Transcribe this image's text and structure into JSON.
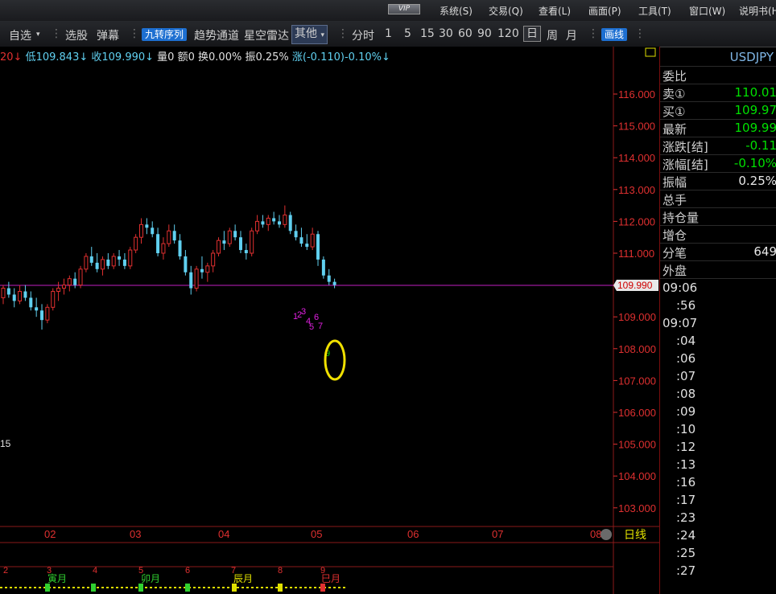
{
  "menubar": {
    "vip_label": "VIP",
    "items": [
      "系统(S)",
      "交易(Q)",
      "查看(L)",
      "画面(P)",
      "工具(T)",
      "窗口(W)",
      "说明书(H)"
    ]
  },
  "toolbar": {
    "favorites": "自选",
    "stock_pick": "选股",
    "popup": "弹幕",
    "nine_turn": "九转序列",
    "trend_channel": "趋势通道",
    "radar": "星空雷达",
    "other": "其他",
    "intraday": "分时",
    "periods": [
      "1",
      "5",
      "15",
      "30",
      "60",
      "90",
      "120"
    ],
    "day": "日",
    "week": "周",
    "month": "月",
    "draw_line": "画线"
  },
  "infoline": {
    "prefix": "20↓",
    "low": "低109.843↓",
    "close": "收109.990↓",
    "volume": "量0",
    "amount": "额0",
    "turnover": "换0.00%",
    "amplitude": "振0.25%",
    "change": "涨(-0.110)-0.10%↓"
  },
  "price_axis": {
    "ticks": [
      "116.000",
      "115.000",
      "114.000",
      "113.000",
      "112.000",
      "111.000",
      "110.000",
      "109.000",
      "108.000",
      "107.000",
      "106.000",
      "105.000",
      "104.000",
      "103.000"
    ],
    "current_price": "109.990"
  },
  "time_axis": {
    "ticks": [
      "02",
      "03",
      "04",
      "05",
      "06",
      "07",
      "08"
    ],
    "period_label": "日线"
  },
  "left_label": "15",
  "nine_turn_labels": [
    "1",
    "2",
    "3",
    "4",
    "5",
    "6",
    "7",
    "9"
  ],
  "bottom_strip": {
    "numbers": [
      "2",
      "3",
      "4",
      "5",
      "6",
      "7",
      "8",
      "9"
    ],
    "months": [
      "寅月",
      "卯月",
      "辰月",
      "巳月"
    ]
  },
  "quote": {
    "symbol": "USDJPY",
    "rows": [
      {
        "label": "委比",
        "value": "",
        "color": "#d0d0d0"
      },
      {
        "label": "卖①",
        "value": "110.01",
        "color": "#00e000"
      },
      {
        "label": "买①",
        "value": "109.97",
        "color": "#00e000"
      },
      {
        "label": "最新",
        "value": "109.99",
        "color": "#00e000"
      },
      {
        "label": "涨跌[结]",
        "value": "-0.11",
        "color": "#00e000"
      },
      {
        "label": "涨幅[结]",
        "value": "-0.10%",
        "color": "#00e000"
      },
      {
        "label": "振幅",
        "value": "0.25%",
        "color": "#e8e8e8"
      },
      {
        "label": "总手",
        "value": "",
        "color": "#e8e8e8"
      },
      {
        "label": "持仓量",
        "value": "",
        "color": "#e8e8e8"
      },
      {
        "label": "增仓",
        "value": "",
        "color": "#e8e8e8"
      },
      {
        "label": "分笔",
        "value": "649",
        "color": "#e8e8e8"
      },
      {
        "label": "外盘",
        "value": "",
        "color": "#e8e8e8"
      }
    ],
    "times": [
      "09:06",
      ":56",
      "09:07",
      ":04",
      ":06",
      ":07",
      ":08",
      ":09",
      ":10",
      ":12",
      ":13",
      ":16",
      ":17",
      ":23",
      ":24",
      ":25",
      ":27"
    ]
  },
  "colors": {
    "up": "#e03030",
    "down": "#60d0f0",
    "nine_turn": "#e020e0",
    "highlight_circle": "#f0e000",
    "price_line": "#c020c0"
  },
  "chart_data": {
    "type": "candlestick",
    "symbol": "USDJPY",
    "last_close": 109.99,
    "ylim": [
      102.6,
      116.6
    ],
    "candles": [
      [
        109.6,
        110.0,
        109.4,
        109.9
      ],
      [
        109.9,
        110.1,
        109.6,
        109.7
      ],
      [
        109.7,
        109.9,
        109.3,
        109.5
      ],
      [
        109.5,
        110.0,
        109.4,
        109.8
      ],
      [
        109.8,
        110.0,
        109.5,
        109.6
      ],
      [
        109.6,
        109.8,
        109.2,
        109.3
      ],
      [
        109.3,
        109.6,
        109.0,
        109.2
      ],
      [
        109.2,
        109.4,
        108.6,
        108.9
      ],
      [
        108.9,
        109.4,
        108.8,
        109.3
      ],
      [
        109.3,
        109.9,
        109.2,
        109.8
      ],
      [
        109.8,
        110.1,
        109.5,
        109.9
      ],
      [
        109.9,
        110.2,
        109.7,
        110.0
      ],
      [
        110.0,
        110.3,
        109.8,
        110.2
      ],
      [
        110.2,
        110.4,
        109.9,
        110.0
      ],
      [
        110.0,
        110.6,
        109.9,
        110.5
      ],
      [
        110.5,
        111.0,
        110.4,
        110.9
      ],
      [
        110.9,
        111.2,
        110.6,
        110.7
      ],
      [
        110.7,
        111.0,
        110.4,
        110.5
      ],
      [
        110.5,
        110.9,
        110.3,
        110.8
      ],
      [
        110.8,
        111.0,
        110.5,
        110.6
      ],
      [
        110.6,
        111.0,
        110.5,
        110.9
      ],
      [
        110.9,
        111.1,
        110.6,
        110.8
      ],
      [
        110.8,
        111.0,
        110.5,
        110.6
      ],
      [
        110.6,
        111.2,
        110.5,
        111.1
      ],
      [
        111.1,
        111.6,
        111.0,
        111.5
      ],
      [
        111.5,
        112.1,
        111.3,
        111.9
      ],
      [
        111.9,
        112.1,
        111.6,
        111.8
      ],
      [
        111.8,
        112.0,
        111.5,
        111.6
      ],
      [
        111.6,
        111.8,
        110.9,
        111.0
      ],
      [
        111.0,
        111.5,
        110.8,
        111.3
      ],
      [
        111.3,
        111.9,
        111.2,
        111.7
      ],
      [
        111.7,
        111.9,
        111.3,
        111.4
      ],
      [
        111.4,
        111.6,
        110.8,
        110.9
      ],
      [
        110.9,
        111.1,
        110.3,
        110.4
      ],
      [
        110.4,
        110.6,
        109.7,
        109.9
      ],
      [
        109.9,
        110.6,
        109.8,
        110.5
      ],
      [
        110.5,
        110.9,
        110.2,
        110.4
      ],
      [
        110.4,
        110.7,
        110.1,
        110.6
      ],
      [
        110.6,
        111.1,
        110.4,
        111.0
      ],
      [
        111.0,
        111.5,
        110.9,
        111.4
      ],
      [
        111.4,
        111.7,
        111.1,
        111.3
      ],
      [
        111.3,
        111.8,
        111.2,
        111.7
      ],
      [
        111.7,
        111.9,
        111.4,
        111.5
      ],
      [
        111.5,
        111.7,
        111.0,
        111.1
      ],
      [
        111.1,
        111.3,
        110.8,
        111.0
      ],
      [
        111.0,
        111.8,
        110.9,
        111.7
      ],
      [
        111.7,
        112.2,
        111.6,
        112.0
      ],
      [
        112.0,
        112.2,
        111.8,
        111.9
      ],
      [
        111.9,
        112.2,
        111.7,
        112.1
      ],
      [
        112.1,
        112.3,
        111.9,
        112.0
      ],
      [
        112.0,
        112.2,
        111.8,
        111.9
      ],
      [
        111.9,
        112.5,
        111.8,
        112.2
      ],
      [
        112.2,
        112.3,
        111.6,
        111.7
      ],
      [
        111.7,
        111.9,
        111.4,
        111.5
      ],
      [
        111.5,
        111.8,
        111.2,
        111.3
      ],
      [
        111.3,
        111.6,
        111.1,
        111.2
      ],
      [
        111.2,
        111.8,
        111.1,
        111.6
      ],
      [
        111.6,
        111.7,
        110.6,
        110.8
      ],
      [
        110.8,
        110.9,
        110.2,
        110.3
      ],
      [
        110.3,
        110.5,
        110.0,
        110.1
      ],
      [
        110.1,
        110.2,
        109.9,
        110.0
      ]
    ]
  }
}
